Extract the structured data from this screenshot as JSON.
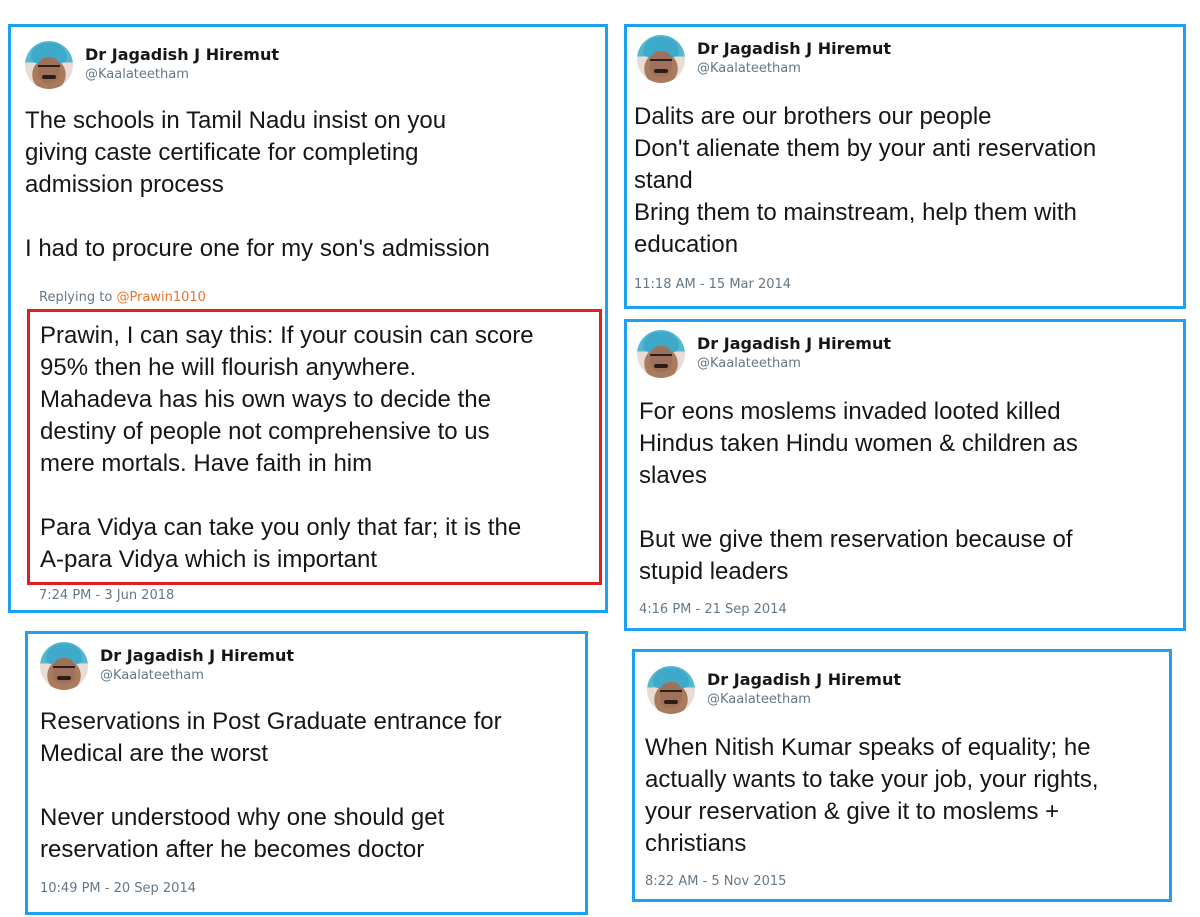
{
  "colors": {
    "card_border": "#1da1f2",
    "highlight_border": "#e02020",
    "mention": "#e8742c",
    "muted": "#657786"
  },
  "author": {
    "name": "Dr Jagadish J Hiremut",
    "handle": "@Kaalateetham",
    "avatar_icon": "profile-avatar"
  },
  "tweets": [
    {
      "text": "The schools in Tamil Nadu insist on you\ngiving caste certificate for completing\nadmission process\n\nI had to procure one for my son's admission",
      "replying_label": "Replying to",
      "replying_mention": "@Prawin1010",
      "reply_text": "Prawin, I can say this: If your cousin can score\n95% then he will flourish anywhere.\nMahadeva has his own ways to decide the\ndestiny of people not comprehensive to us\nmere mortals. Have faith in him\n\nPara Vidya can take you only that far; it is the\nA-para Vidya which is important",
      "time": "7:24 PM - 3 Jun 2018"
    },
    {
      "text": "Dalits are our brothers our people\nDon't alienate them by your anti reservation\nstand\nBring them to mainstream, help them with\neducation",
      "time": "11:18 AM - 15 Mar 2014"
    },
    {
      "text": "For eons moslems invaded looted killed\nHindus taken Hindu women & children as\nslaves\n\nBut we give them reservation because of\nstupid leaders",
      "time": "4:16 PM - 21 Sep 2014"
    },
    {
      "text": "Reservations in Post Graduate entrance for\nMedical are the worst\n\nNever understood why one should get\nreservation after he becomes doctor",
      "time": "10:49 PM - 20 Sep 2014"
    },
    {
      "text": "When Nitish Kumar speaks of equality; he\nactually wants to take your job, your rights,\nyour reservation & give it to moslems +\nchristians",
      "time": "8:22 AM - 5 Nov 2015"
    }
  ]
}
